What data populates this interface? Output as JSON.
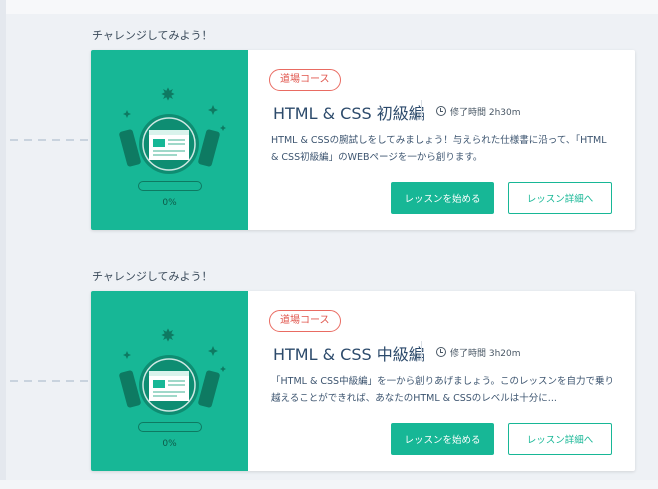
{
  "courses": [
    {
      "heading": "チャレンジしてみよう！",
      "badge": "道場コース",
      "title": "HTML & CSS 初級編",
      "time": "修了時間 2h30m",
      "description": "HTML & CSSの腕試しをしてみましょう！与えられた仕様書に沿って、「HTML & CSS初級編」のWEBページを一から創ります。",
      "progress_label": "0%",
      "progress": 0,
      "start_label": "レッスンを始める",
      "detail_label": "レッスン詳細へ"
    },
    {
      "heading": "チャレンジしてみよう！",
      "badge": "道場コース",
      "title": "HTML & CSS 中級編",
      "time": "修了時間 3h20m",
      "description": "「HTML & CSS中級編」を一から創りあげましょう。このレッスンを自力で乗り越えることができれば、あなたのHTML & CSSのレベルは十分に...",
      "progress_label": "0%",
      "progress": 0,
      "start_label": "レッスンを始める",
      "detail_label": "レッスン詳細へ"
    }
  ],
  "colors": {
    "accent": "#17b796",
    "badge": "#e0554c",
    "title": "#2c4a6b"
  }
}
